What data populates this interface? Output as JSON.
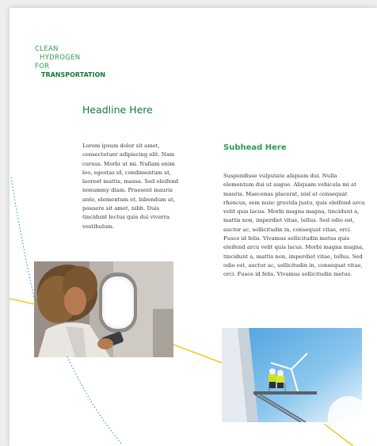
{
  "logo": {
    "line1": "CLEAN",
    "line2": "HYDROGEN",
    "line3": "FOR",
    "line4": "TRANSPORTATION"
  },
  "headline": "Headline Here",
  "subhead": "Subhead Here",
  "body_left": "Lorem ipsum dolor sit amet, consectetuer adipiscing elit. Nam cursus. Morbi ut mi. Nullam enim leo, egestas id, condimentum at, laoreet mattis, massa. Sed eleifend nonummy diam. Praesent mauris ante, elementum et, bibendum at, posuere sit amet, nibh. Duis tincidunt lectus quis dui viverra vestibulum.",
  "body_right": "Suspendisse vulputate aliquam dui. Nulla elementum dui ut augue. Aliquam vehicula mi at mauris. Maecenas placerat, nisl at consequat rhoncus, sem nunc gravida justo, quis eleifend arcu velit quis lacus. Morbi magna magna, tincidunt a, mattis non, imperdiet vitae, tellus. Sed odio est, auctor ac, sollicitudin in, consequat vitae, orci. Fusce id felis. Vivamus sollicitudin metus quis eleifend arcu velit quis lacus. Morbi magna magna, tincidunt a, mattis non, imperdiet vitae, tellus. Sed odio est, auctor ac, sollicitudin in, consequat vitae, orci. Fusce id felis. Vivamus sollicitudin metus.",
  "colors": {
    "brand_green": "#2e9c4f",
    "dark_green": "#0f7a3a",
    "accent_yellow": "#f2c200",
    "accent_blue_dots": "#2e86c8"
  }
}
